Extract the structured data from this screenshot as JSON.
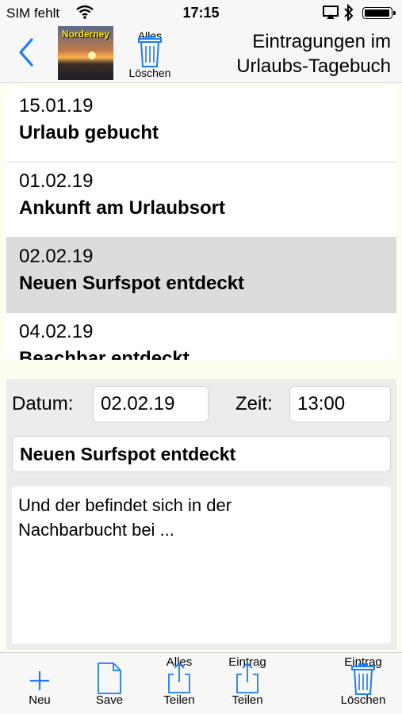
{
  "status_bar": {
    "carrier": "SIM fehlt",
    "time": "17:15",
    "icons": [
      "wifi-icon",
      "airplay-icon",
      "bluetooth-icon",
      "battery-icon"
    ]
  },
  "nav": {
    "back_icon": "chevron-left-icon",
    "thumbnail_label": "Norderney",
    "delete_all_top": "Alles",
    "delete_all_bottom": "Löschen",
    "title_line1": "Eintragungen im",
    "title_line2": "Urlaubs-Tagebuch"
  },
  "entries": [
    {
      "date": "15.01.19",
      "title": "Urlaub gebucht",
      "selected": false
    },
    {
      "date": "01.02.19",
      "title": "Ankunft am Urlaubsort",
      "selected": false
    },
    {
      "date": "02.02.19",
      "title": "Neuen Surfspot entdeckt",
      "selected": true
    },
    {
      "date": "04.02.19",
      "title": "Beachbar entdeckt",
      "selected": false
    }
  ],
  "form": {
    "date_label": "Datum:",
    "date_value": "02.02.19",
    "time_label": "Zeit:",
    "time_value": "13:00",
    "title_value": "Neuen Surfspot entdeckt",
    "note_line1": "Und der befindet sich in der",
    "note_line2": "Nachbarbucht bei ..."
  },
  "toolbar": {
    "new_label": "Neu",
    "save_label": "Save",
    "share_all_top": "Alles",
    "share_all_bottom": "Teilen",
    "share_entry_top": "Eintrag",
    "share_entry_bottom": "Teilen",
    "delete_entry_top": "Eintrag",
    "delete_entry_bottom": "Löschen"
  },
  "colors": {
    "accent": "#1a7cf7",
    "selected_row": "#dcdcdc",
    "background": "#fdfdf0"
  }
}
